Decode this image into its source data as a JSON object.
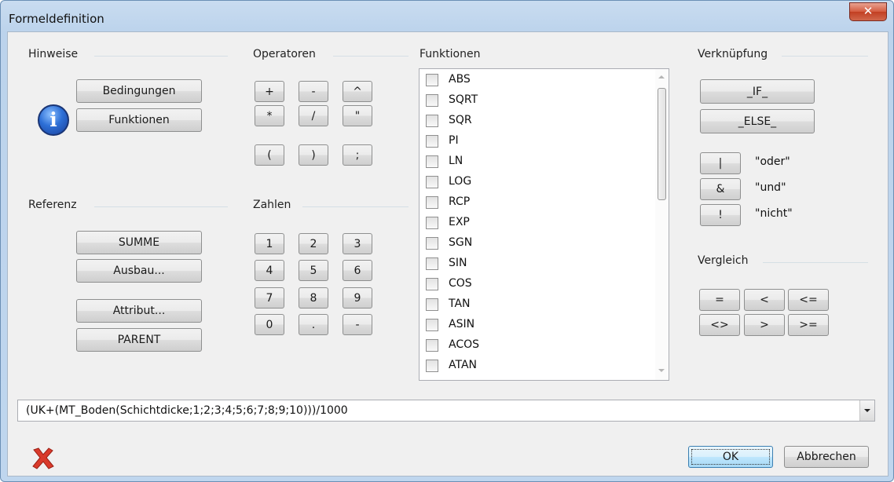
{
  "window": {
    "title": "Formeldefinition",
    "close_icon": "close-icon"
  },
  "hinweise": {
    "label": "Hinweise",
    "buttons": [
      "Bedingungen",
      "Funktionen"
    ],
    "icon": "info-icon"
  },
  "referenz": {
    "label": "Referenz",
    "buttons": [
      "SUMME",
      "Ausbau...",
      "Attribut...",
      "PARENT"
    ]
  },
  "operatoren": {
    "label": "Operatoren",
    "buttons": [
      "+",
      "-",
      "^",
      "*",
      "/",
      "\"",
      "(",
      ")",
      ";"
    ]
  },
  "zahlen": {
    "label": "Zahlen",
    "buttons": [
      "1",
      "2",
      "3",
      "4",
      "5",
      "6",
      "7",
      "8",
      "9",
      "0",
      ".",
      "-"
    ]
  },
  "funktionen": {
    "label": "Funktionen",
    "items": [
      "ABS",
      "SQRT",
      "SQR",
      "PI",
      "LN",
      "LOG",
      "RCP",
      "EXP",
      "SGN",
      "SIN",
      "COS",
      "TAN",
      "ASIN",
      "ACOS",
      "ATAN"
    ]
  },
  "verknuepfung": {
    "label": "Verknüpfung",
    "buttons": [
      "_IF_",
      "_ELSE_"
    ],
    "logic": [
      {
        "symbol": "|",
        "desc": "\"oder\""
      },
      {
        "symbol": "&",
        "desc": "\"und\""
      },
      {
        "symbol": "!",
        "desc": "\"nicht\""
      }
    ]
  },
  "vergleich": {
    "label": "Vergleich",
    "buttons": [
      "=",
      "<",
      "<=",
      "<>",
      ">",
      ">="
    ]
  },
  "formula": {
    "value": "(UK+(MT_Boden(Schichtdicke;1;2;3;4;5;6;7;8;9;10)))/1000"
  },
  "footer": {
    "ok_label": "OK",
    "cancel_label": "Abbrechen",
    "delete_icon": "red-x-icon"
  },
  "colors": {
    "accent_red": "#d93a2b",
    "frame_blue": "#bfd6ee"
  }
}
